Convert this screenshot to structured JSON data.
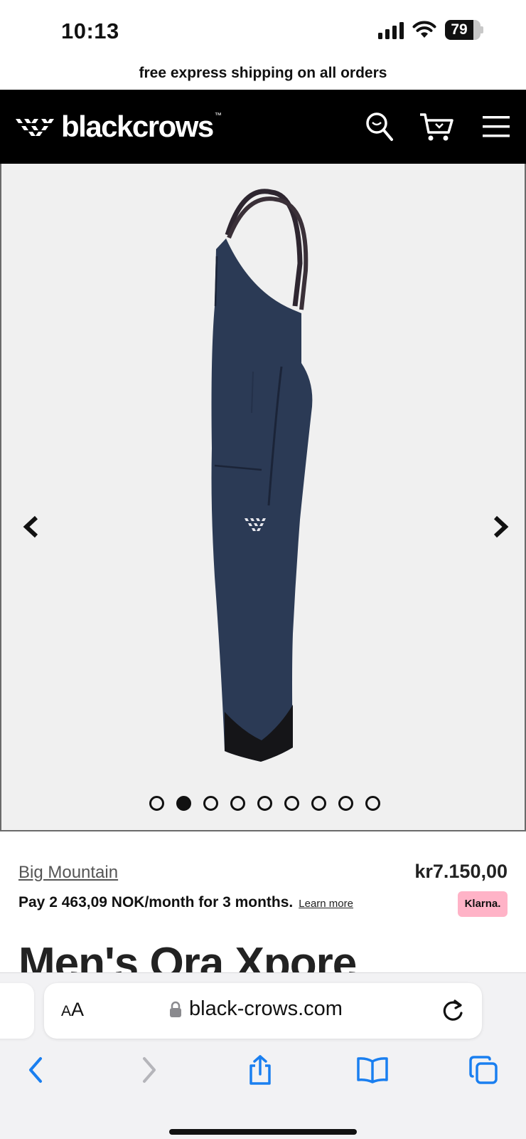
{
  "status_bar": {
    "time": "10:13",
    "battery": "79",
    "battery_level": 0.79
  },
  "promo_banner": "free express shipping on all orders",
  "header": {
    "logo_text": "blackcrows",
    "logo_tm": "™",
    "icons": [
      "search-icon",
      "cart-icon",
      "menu-icon"
    ]
  },
  "carousel": {
    "slide_count": 9,
    "active_slide": 2,
    "icons": [
      "chevron-left-icon",
      "chevron-right-icon"
    ]
  },
  "product": {
    "category": "Big Mountain",
    "price": "kr7.150,00",
    "installment_text": "Pay 2 463,09 NOK/month for 3 months.",
    "learn_more": "Learn more",
    "klarna_badge": "Klarna.",
    "title": "Men's Ora Xpore"
  },
  "browser": {
    "aa_label_small": "A",
    "aa_label_large": "A",
    "url": "black-crows.com",
    "icons": [
      "lock-icon",
      "reload-icon",
      "back-icon",
      "forward-icon",
      "share-icon",
      "bookmarks-icon",
      "tabs-icon"
    ]
  },
  "colors": {
    "header_bg": "#000000",
    "product_navy": "#2b3a55",
    "klarna_pink": "#ffb3c7",
    "safari_blue": "#1a7ff0"
  }
}
